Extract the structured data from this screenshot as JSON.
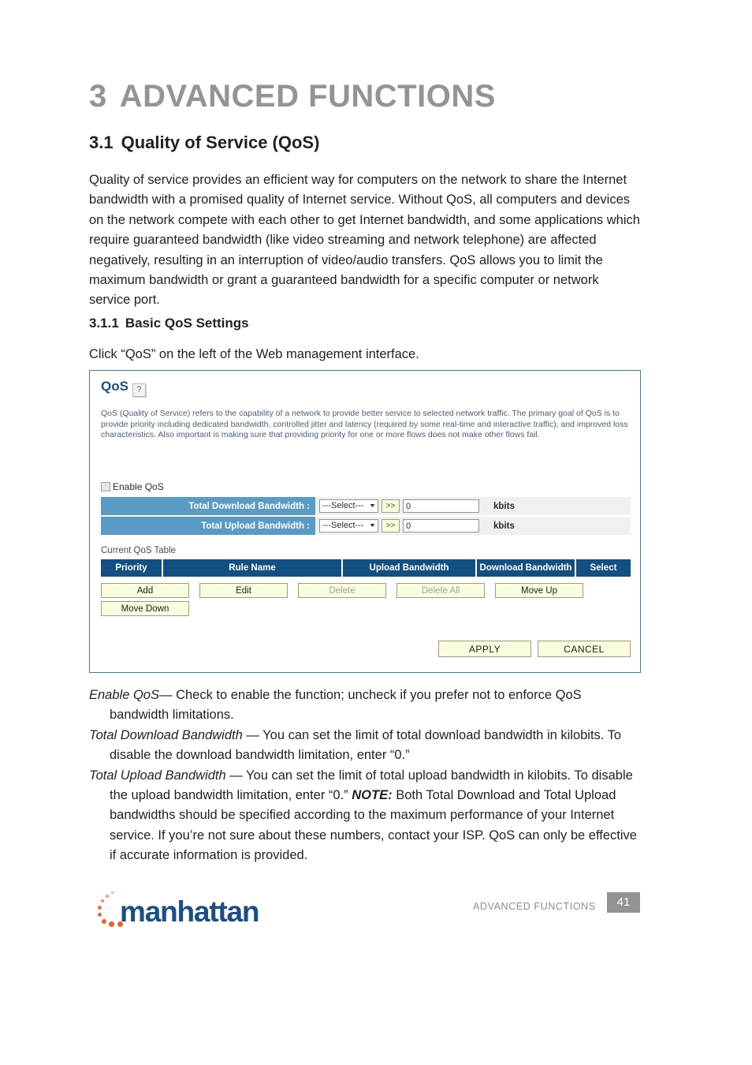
{
  "chapter": {
    "number": "3",
    "title": "ADVANCED FUNCTIONS"
  },
  "section": {
    "number": "3.1",
    "title": "Quality of Service (QoS)"
  },
  "intro_paragraph": "Quality of service provides an efficient way for computers on the network to share the Internet bandwidth with a promised quality of Internet service. Without QoS, all computers and devices on the network compete with each other to get Internet bandwidth, and some applications which require guaranteed bandwidth (like video streaming and network telephone) are affected negatively, resulting in an interruption of video/audio transfers. QoS allows you to limit the maximum bandwidth or grant a guaranteed bandwidth for a specific computer or network service port.",
  "subsection": {
    "number": "3.1.1",
    "title": "Basic QoS Settings"
  },
  "instruction": "Click “QoS” on the left of the Web management interface.",
  "screenshot": {
    "panel_title": "QoS",
    "help_icon_glyph": "?",
    "description": "QoS (Quality of Service) refers to the capability of a network to provide better service to selected network traffic. The primary goal of QoS is to provide priority including dedicated bandwidth, controlled jitter and latency (required by some real-time and interactive traffic), and improved loss characteristics. Also important is making sure that providing priority for one or more flows does not make other flows fail.",
    "enable_checkbox": {
      "label": "Enable QoS",
      "checked": false
    },
    "bandwidth_rows": [
      {
        "label": "Total Download Bandwidth :",
        "select_value": "---Select---",
        "go_label": ">>",
        "input_value": "0",
        "unit": "kbits"
      },
      {
        "label": "Total Upload Bandwidth :",
        "select_value": "---Select---",
        "go_label": ">>",
        "input_value": "0",
        "unit": "kbits"
      }
    ],
    "table_caption": "Current QoS Table",
    "table_headers": [
      "Priority",
      "Rule Name",
      "Upload Bandwidth",
      "Download Bandwidth",
      "Select"
    ],
    "table_rows": [],
    "action_buttons": [
      {
        "label": "Add",
        "disabled": false
      },
      {
        "label": "Edit",
        "disabled": false
      },
      {
        "label": "Delete",
        "disabled": true
      },
      {
        "label": "Delete All",
        "disabled": true
      },
      {
        "label": "Move Up",
        "disabled": false
      }
    ],
    "action_buttons_row2": [
      {
        "label": "Move Down",
        "disabled": false
      }
    ],
    "footer_buttons": [
      {
        "label": "APPLY"
      },
      {
        "label": "CANCEL"
      }
    ],
    "colors": {
      "panel_border": "#3c7cb4",
      "title_blue": "#1b4f8a",
      "label_cell_blue": "#5a9bc6",
      "table_header_blue": "#125083",
      "button_cream": "#fbfbdd"
    }
  },
  "definitions": [
    {
      "term": "Enable QoS",
      "dash": "—",
      "text": " Check to enable the function; uncheck if you prefer not to enforce QoS bandwidth limitations."
    },
    {
      "term": "Total Download Bandwidth ",
      "dash": "—",
      "text": " You can set the limit of total download bandwidth in kilobits. To disable the download bandwidth limitation, enter “0.”"
    },
    {
      "term": "Total Upload Bandwidth ",
      "dash": "—",
      "text_before_note": " You can set the limit of total upload bandwidth in kilobits. To disable the upload bandwidth limitation, enter “0.” ",
      "note_label": "NOTE:",
      "text_after_note": " Both Total Download and Total Upload bandwidths should be specified according to the maximum performance of your Internet service. If you’re not sure about these numbers, contact your ISP. QoS can only be effective if accurate information is provided."
    }
  ],
  "footer": {
    "brand": "manhattan",
    "running_head": "ADVANCED FUNCTIONS",
    "page_number": "41",
    "brand_color": "#1b4e83",
    "dot_color": "#e8622a",
    "badge_color": "#939393"
  }
}
